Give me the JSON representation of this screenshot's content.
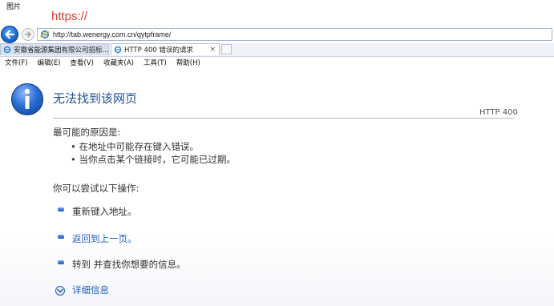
{
  "top_label": "图片",
  "annotation": "https://",
  "browser": {
    "address_url": "http://tab.wenergy.com.cn/qytpframe/",
    "tabs": [
      {
        "title": "安徽省能源集团有限公司招标..."
      },
      {
        "title": "HTTP 400 错误的请求",
        "close": "×"
      }
    ],
    "menu": [
      "文件(F)",
      "编辑(E)",
      "查看(V)",
      "收藏夹(A)",
      "工具(T)",
      "帮助(H)"
    ]
  },
  "page": {
    "title": "无法找到该网页",
    "http_code": "HTTP 400",
    "cause_heading": "最可能的原因是:",
    "causes": [
      "• 在地址中可能存在键入错误。",
      "• 当你点击某个链接时，它可能已过期。"
    ],
    "try_heading": "你可以尝试以下操作:",
    "options": [
      "重新键入地址。",
      "返回到上一页。",
      "转到  并查找你想要的信息。"
    ],
    "more_info": "详细信息"
  },
  "icons": {
    "back": "back-arrow-icon",
    "forward": "forward-arrow-icon",
    "ie": "ie-logo-icon",
    "info": "info-icon",
    "more": "chevron-down-icon"
  },
  "colors": {
    "title": "#1f4f9a",
    "link": "#1f5fbf",
    "annotation": "#e53935"
  }
}
